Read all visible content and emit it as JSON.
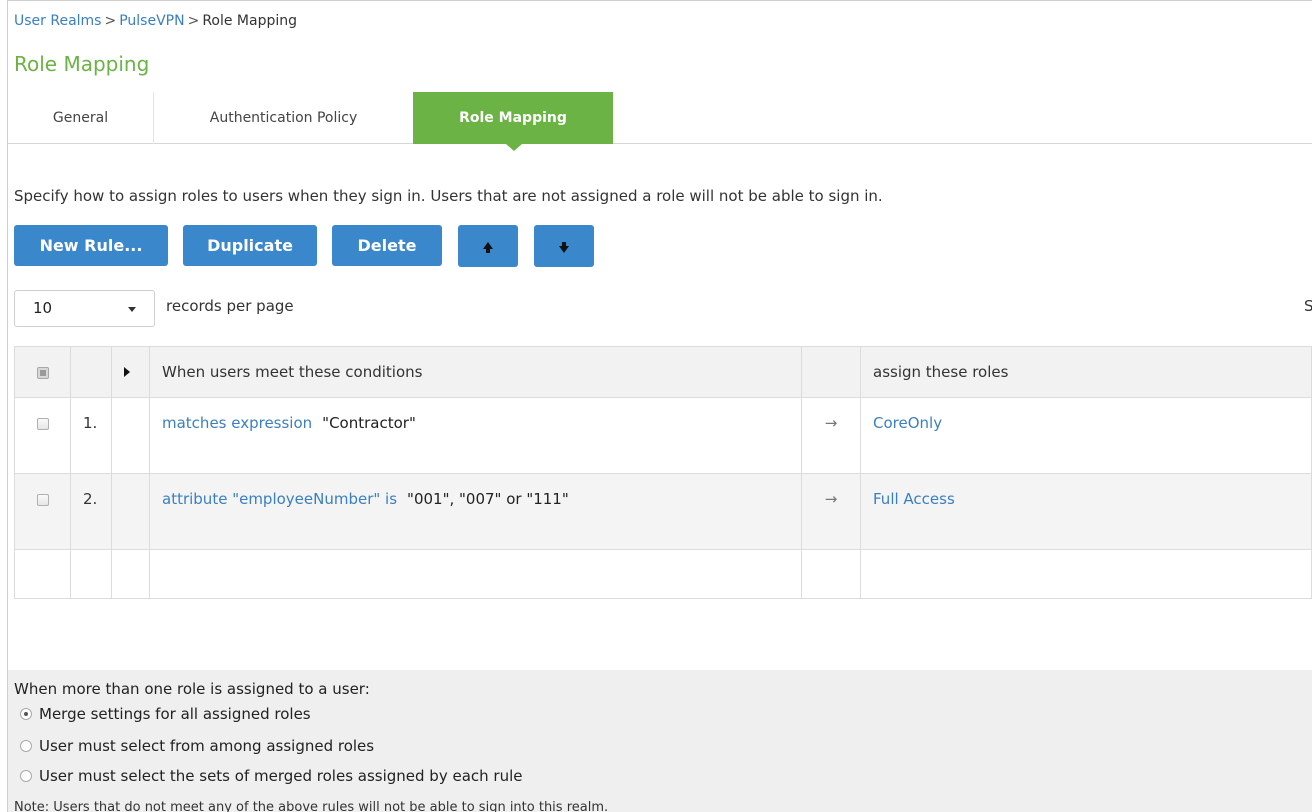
{
  "breadcrumb": {
    "items": [
      "User Realms",
      "PulseVPN"
    ],
    "separator": ">",
    "current": "Role Mapping"
  },
  "page_title": "Role Mapping",
  "tabs": [
    {
      "label": "General"
    },
    {
      "label": "Authentication Policy"
    },
    {
      "label": "Role Mapping",
      "active": true
    }
  ],
  "description": "Specify how to assign roles to users when they sign in. Users that are not assigned a role will not be able to sign in.",
  "toolbar": {
    "new_rule_label": "New Rule...",
    "duplicate_label": "Duplicate",
    "delete_label": "Delete",
    "move_up_icon": "arrow-up-icon",
    "move_down_icon": "arrow-down-icon"
  },
  "paging": {
    "records_per_page_value": "10",
    "records_per_page_label": "records per page",
    "truncated_right_text": "S"
  },
  "table": {
    "headers": {
      "conditions": "When users meet these conditions",
      "roles": "assign these roles"
    },
    "rows": [
      {
        "number": "1.",
        "condition_link": "matches expression",
        "condition_value": "\"Contractor\"",
        "arrow": "→",
        "role": "CoreOnly"
      },
      {
        "number": "2.",
        "condition_link": "attribute \"employeeNumber\" is",
        "condition_value": "\"001\", \"007\" or \"111\"",
        "arrow": "→",
        "role": "Full Access"
      }
    ]
  },
  "multi_role": {
    "heading": "When more than one role is assigned to a user:",
    "options": [
      {
        "label": "Merge settings for all assigned roles",
        "selected": true
      },
      {
        "label": "User must select from among assigned roles",
        "selected": false
      },
      {
        "label": "User must select the sets of merged roles assigned by each rule",
        "selected": false
      }
    ]
  },
  "note": "Note: Users that do not meet any of the above rules will not be able to sign into this realm.",
  "colors": {
    "accent_green": "#6ab344",
    "button_blue": "#3a87cc",
    "link_blue": "#3a7fc1"
  }
}
